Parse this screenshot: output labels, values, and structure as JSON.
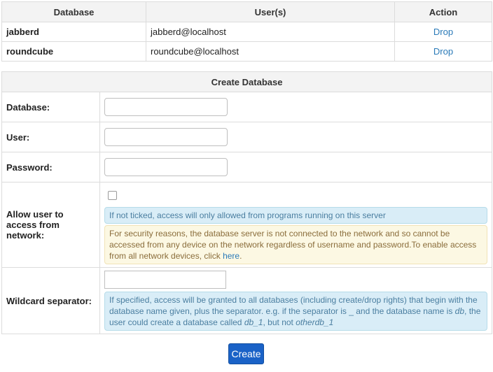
{
  "databases_table": {
    "headers": [
      "Database",
      "User(s)",
      "Action"
    ],
    "rows": [
      {
        "database": "jabberd",
        "user": "jabberd@localhost",
        "action": "Drop"
      },
      {
        "database": "roundcube",
        "user": "roundcube@localhost",
        "action": "Drop"
      }
    ]
  },
  "create_form": {
    "title": "Create Database",
    "database_label": "Database:",
    "database_value": "",
    "user_label": "User:",
    "user_value": "",
    "password_label": "Password:",
    "password_value": "",
    "network_label": "Allow user to access from network:",
    "network_checked": false,
    "network_info": "If not ticked, access will only allowed from programs running on this server",
    "network_warning_text": "For security reasons, the database server is not connected to the network and so cannot be accessed from any device on the network regardless of username and password.To enable access from all network devices, click",
    "network_warning_link": "here",
    "network_warning_end": ".",
    "wildcard_label": "Wildcard separator:",
    "wildcard_value": "",
    "wildcard_info_1": "If specified, access will be granted to all databases (including create/drop rights) that begin with the database name given, plus the separator. e.g. if the separator is _ and the database name is",
    "wildcard_info_db": "db",
    "wildcard_info_2": ", the user could create a database called",
    "wildcard_info_db1": "db_1",
    "wildcard_info_3": ", but not",
    "wildcard_info_other": "otherdb_1",
    "create_button": "Create"
  },
  "colors": {
    "link": "#2a7ab8",
    "button": "#1a62c7",
    "info_bg": "#d9edf7",
    "warning_bg": "#fcf8e3"
  }
}
